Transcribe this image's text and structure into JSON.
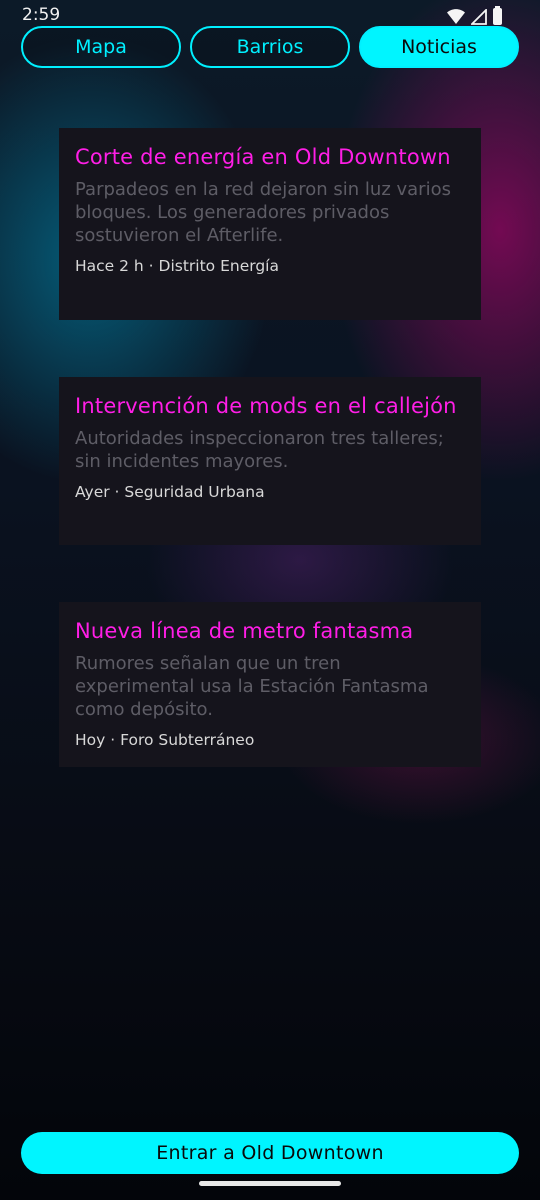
{
  "status_bar": {
    "time": "2:59",
    "icons": [
      "wifi-icon",
      "signal-icon",
      "battery-icon"
    ]
  },
  "tabs": [
    {
      "label": "Mapa",
      "active": false
    },
    {
      "label": "Barrios",
      "active": false
    },
    {
      "label": "Noticias",
      "active": true
    }
  ],
  "news": [
    {
      "title": "Corte de energía en Old Downtown",
      "summary": "Parpadeos en la red dejaron sin luz varios bloques. Los generadores privados sostuvieron el Afterlife.",
      "meta": "Hace 2 h · Distrito Energía"
    },
    {
      "title": "Intervención de mods en el callejón",
      "summary": "Autoridades inspeccionaron tres talleres; sin incidentes mayores.",
      "meta": "Ayer · Seguridad Urbana"
    },
    {
      "title": "Nueva línea de metro fantasma",
      "summary": "Rumores señalan que un tren experimental usa la Estación Fantasma como depósito.",
      "meta": "Hoy · Foro Subterráneo"
    }
  ],
  "cta": {
    "label": "Entrar a Old Downtown"
  },
  "colors": {
    "accent": "#00f5ff",
    "headline": "#ff1ee6",
    "card_bg": "#15141c",
    "summary_text": "#5e5d66"
  }
}
